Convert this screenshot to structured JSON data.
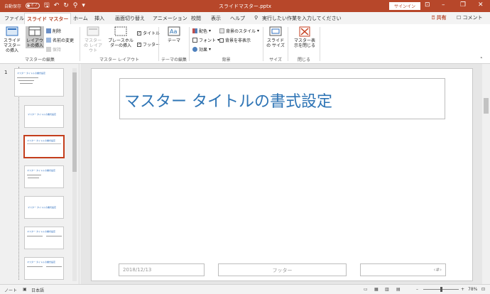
{
  "titlebar": {
    "autosave": "自動保存",
    "autosave_state": "オフ",
    "filename": "スライドマスター.pptx",
    "signin": "サインイン"
  },
  "tabs": [
    "ファイル",
    "スライド マスター",
    "ホーム",
    "挿入",
    "画面切り替え",
    "アニメーション",
    "校閲",
    "表示",
    "ヘルプ"
  ],
  "tell_me": "実行したい作業を入力してください",
  "share": "共有",
  "comment": "コメント",
  "ribbon": {
    "g1": {
      "insert_master": "スライド マスターの挿入",
      "insert_layout": "レイアウトの挿入",
      "delete": "削除",
      "rename": "名前の変更",
      "preserve": "保持",
      "label": "マスターの編集"
    },
    "g2": {
      "master_layout": "マスターの レイアウト",
      "insert_placeholder": "プレースホルダーの挿入",
      "title_chk": "タイトル",
      "footer_chk": "フッター",
      "label": "マスター レイアウト"
    },
    "g3": {
      "theme": "テーマ",
      "label": "テーマの編集"
    },
    "g4": {
      "colors": "配色",
      "fonts": "フォント",
      "effects": "効果",
      "bg_styles": "背景のスタイル",
      "hide_bg": "背景を非表示",
      "label": "背景"
    },
    "g5": {
      "slide_size": "スライドの サイズ",
      "label": "サイズ"
    },
    "g6": {
      "close_master": "マスター表示を閉じる",
      "label": "閉じる"
    }
  },
  "thumbnails": {
    "number": "1",
    "master_title": "マスター タイトルの書式設定",
    "title_short": "マスター タイトルの書式設定"
  },
  "slide": {
    "title": "マスター タイトルの書式設定",
    "date": "2018/12/13",
    "footer": "フッター",
    "pagenum": "‹#›"
  },
  "status": {
    "view": "ノート",
    "language": "日本語",
    "zoom": "78%"
  },
  "colors": {
    "accent": "#b7472a",
    "title_text": "#2e74b5"
  }
}
